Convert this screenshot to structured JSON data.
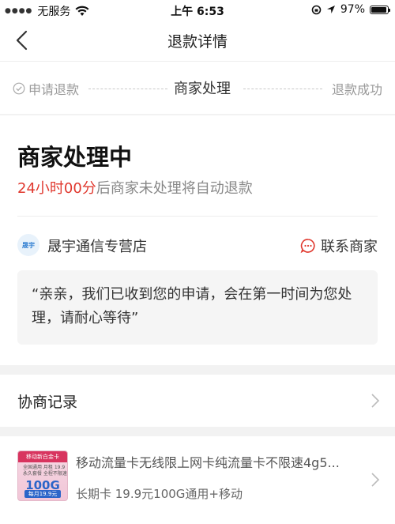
{
  "status_bar": {
    "carrier": "无服务",
    "time": "上午 6:53",
    "battery": "97%",
    "battery_level": 0.97
  },
  "nav": {
    "title": "退款详情"
  },
  "steps": [
    {
      "label": "申请退款",
      "state": "done"
    },
    {
      "label": "商家处理",
      "state": "current"
    },
    {
      "label": "退款成功",
      "state": "pending"
    }
  ],
  "status": {
    "title": "商家处理中",
    "countdown": "24小时00分",
    "subtitle_rest": "后商家未处理将自动退款"
  },
  "store": {
    "logo_text": "晟宇",
    "name": "晟宇通信专营店",
    "contact_label": "联系商家"
  },
  "message": "“亲亲，我们已收到您的申请，会在第一时间为您处理，请耐心等待”",
  "record": {
    "label": "协商记录"
  },
  "product": {
    "title": "移动流量卡无线限上网卡纯流量卡不限速4g5...",
    "spec": "长期卡 19.9元100G通用+移动",
    "image_texts": {
      "top": "移动新白金卡",
      "lines": [
        "全国通用 月租 19.9",
        "永久套餐 全程不限速"
      ],
      "big": "100G",
      "bottom": "每月19.9元"
    }
  },
  "colors": {
    "accent_red": "#e0382e",
    "page_bg": "#f2f2f2"
  }
}
